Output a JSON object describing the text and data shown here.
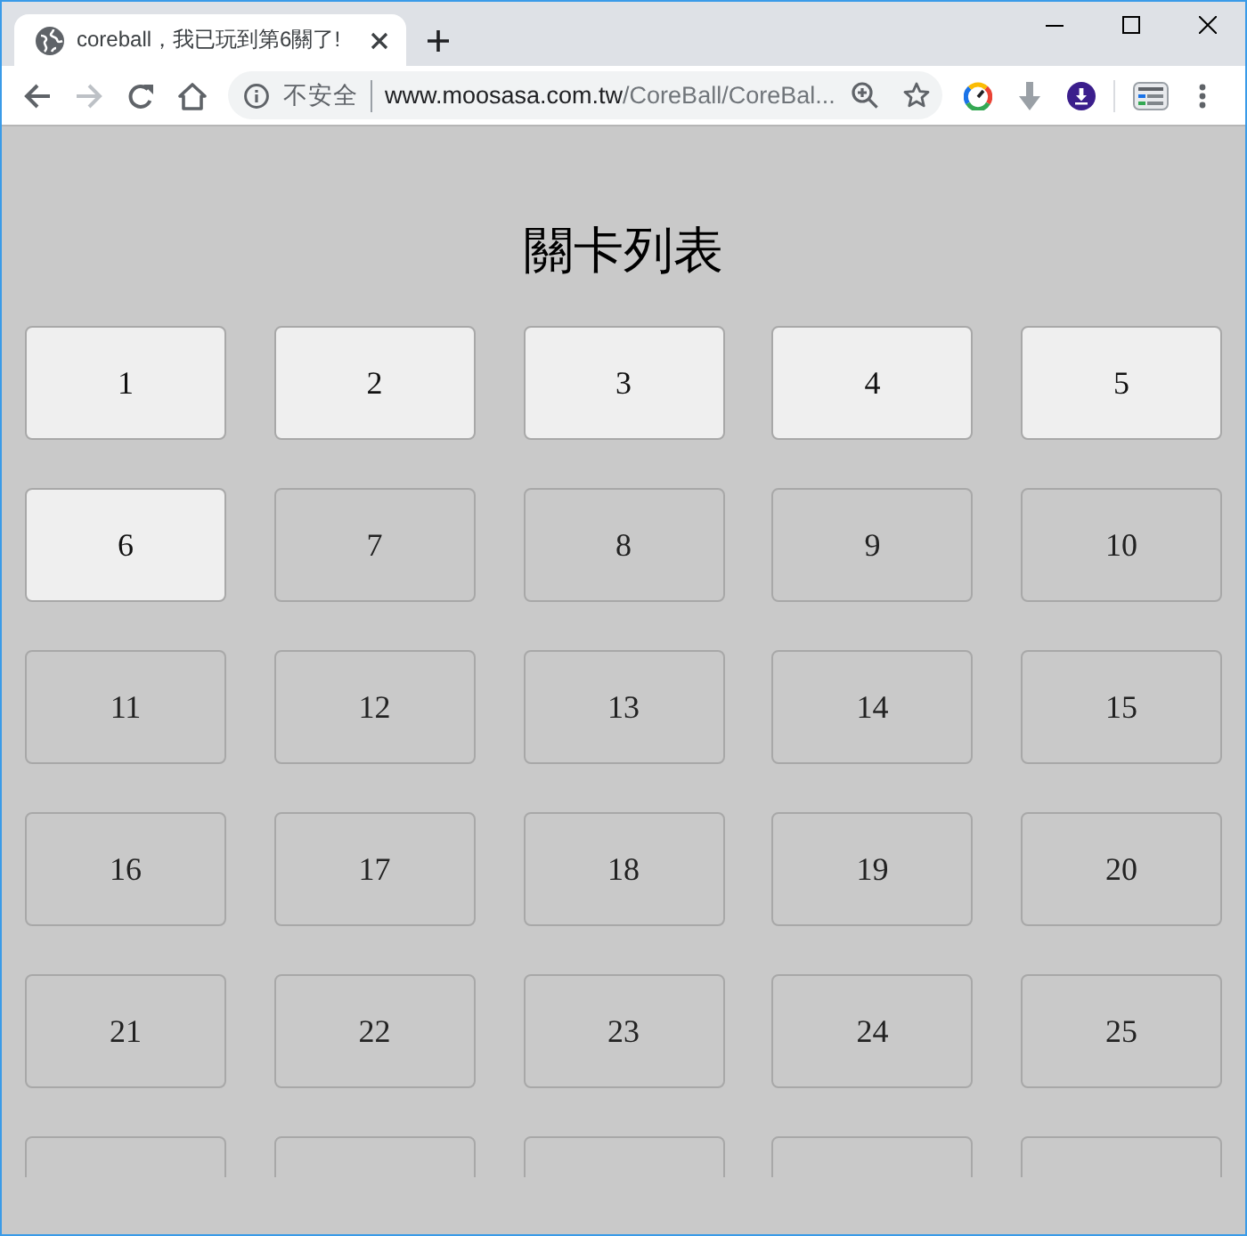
{
  "window": {
    "tab": {
      "title": "coreball，我已玩到第6關了!"
    }
  },
  "toolbar": {
    "forward": {
      "disabled": true
    },
    "security_label": "不安全",
    "url_host": "www.moosasa.com.tw",
    "url_path": "/CoreBall/CoreBal..."
  },
  "page": {
    "title": "關卡列表",
    "levels": [
      {
        "label": "1",
        "unlocked": true
      },
      {
        "label": "2",
        "unlocked": true
      },
      {
        "label": "3",
        "unlocked": true
      },
      {
        "label": "4",
        "unlocked": true
      },
      {
        "label": "5",
        "unlocked": true
      },
      {
        "label": "6",
        "unlocked": true
      },
      {
        "label": "7",
        "unlocked": false
      },
      {
        "label": "8",
        "unlocked": false
      },
      {
        "label": "9",
        "unlocked": false
      },
      {
        "label": "10",
        "unlocked": false
      },
      {
        "label": "11",
        "unlocked": false
      },
      {
        "label": "12",
        "unlocked": false
      },
      {
        "label": "13",
        "unlocked": false
      },
      {
        "label": "14",
        "unlocked": false
      },
      {
        "label": "15",
        "unlocked": false
      },
      {
        "label": "16",
        "unlocked": false
      },
      {
        "label": "17",
        "unlocked": false
      },
      {
        "label": "18",
        "unlocked": false
      },
      {
        "label": "19",
        "unlocked": false
      },
      {
        "label": "20",
        "unlocked": false
      },
      {
        "label": "21",
        "unlocked": false
      },
      {
        "label": "22",
        "unlocked": false
      },
      {
        "label": "23",
        "unlocked": false
      },
      {
        "label": "24",
        "unlocked": false
      },
      {
        "label": "25",
        "unlocked": false
      },
      {
        "unlocked": false
      },
      {
        "unlocked": false
      },
      {
        "unlocked": false
      },
      {
        "unlocked": false
      },
      {
        "unlocked": false
      }
    ]
  }
}
